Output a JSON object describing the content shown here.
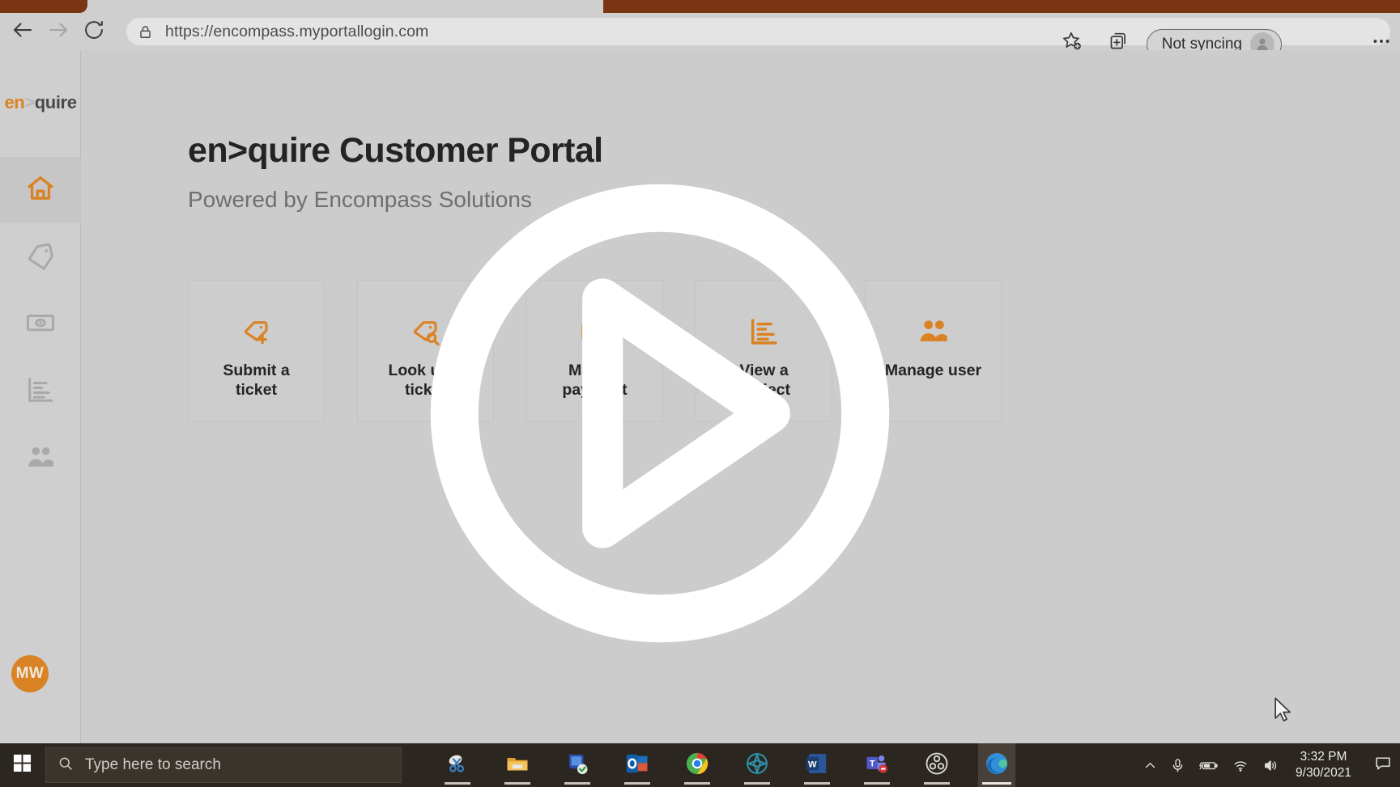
{
  "browser": {
    "url_scheme": "https://",
    "url_host": "encompass.myportallogin.com",
    "url_full": "https://encompass.myportallogin.com",
    "back_icon": "back-arrow-icon",
    "forward_icon": "forward-arrow-icon",
    "reload_icon": "reload-icon",
    "lock_icon": "lock-icon",
    "favorite_icon": "star-add-icon",
    "collections_icon": "collections-icon",
    "profile_label": "Not syncing",
    "profile_icon": "person-avatar-icon",
    "more_icon": "ellipsis-icon",
    "tab_color": "#7a3512"
  },
  "sidebar": {
    "brand": {
      "prefix": "en",
      "separator": ">",
      "suffix": "quire"
    },
    "items": [
      {
        "name": "home",
        "icon": "home-icon",
        "active": true
      },
      {
        "name": "tickets",
        "icon": "tag-icon",
        "active": false
      },
      {
        "name": "billing",
        "icon": "money-bill-icon",
        "active": false
      },
      {
        "name": "reports",
        "icon": "bar-chart-icon",
        "active": false
      },
      {
        "name": "users",
        "icon": "people-icon",
        "active": false
      }
    ],
    "user_initials": "MW",
    "accent_color": "#d98324"
  },
  "main": {
    "title": "en>quire Customer Portal",
    "subtitle": "Powered by Encompass Solutions",
    "cards": [
      {
        "label": "Submit a ticket",
        "icon": "tag-plus-icon"
      },
      {
        "label": "Look up a ticket",
        "icon": "tag-search-icon"
      },
      {
        "label": "Make a payment",
        "icon": "money-bill-icon"
      },
      {
        "label": "View a project",
        "icon": "project-chart-icon"
      },
      {
        "label": "Manage user",
        "icon": "people-icon"
      }
    ]
  },
  "overlay": {
    "icon": "play-button-icon",
    "color": "#ffffff"
  },
  "taskbar": {
    "start_icon": "windows-start-icon",
    "search_icon": "search-icon",
    "search_placeholder": "Type here to search",
    "apps": [
      {
        "name": "snipping-tool",
        "running": true
      },
      {
        "name": "file-explorer",
        "running": true
      },
      {
        "name": "remote-desktop",
        "running": true
      },
      {
        "name": "outlook",
        "running": true
      },
      {
        "name": "chrome",
        "running": true
      },
      {
        "name": "compass-app",
        "running": true
      },
      {
        "name": "word",
        "running": true
      },
      {
        "name": "teams",
        "running": true
      },
      {
        "name": "obs-studio",
        "running": true
      },
      {
        "name": "microsoft-edge",
        "running": true,
        "active": true
      }
    ],
    "tray": [
      {
        "name": "show-hidden-icons",
        "icon": "chevron-up-icon"
      },
      {
        "name": "microphone",
        "icon": "microphone-icon"
      },
      {
        "name": "battery",
        "icon": "battery-charging-icon"
      },
      {
        "name": "network",
        "icon": "wifi-icon"
      },
      {
        "name": "volume",
        "icon": "speaker-icon"
      }
    ],
    "time": "3:32 PM",
    "date": "9/30/2021",
    "notification_icon": "notification-icon"
  },
  "cursor": {
    "icon": "mouse-pointer-icon"
  }
}
